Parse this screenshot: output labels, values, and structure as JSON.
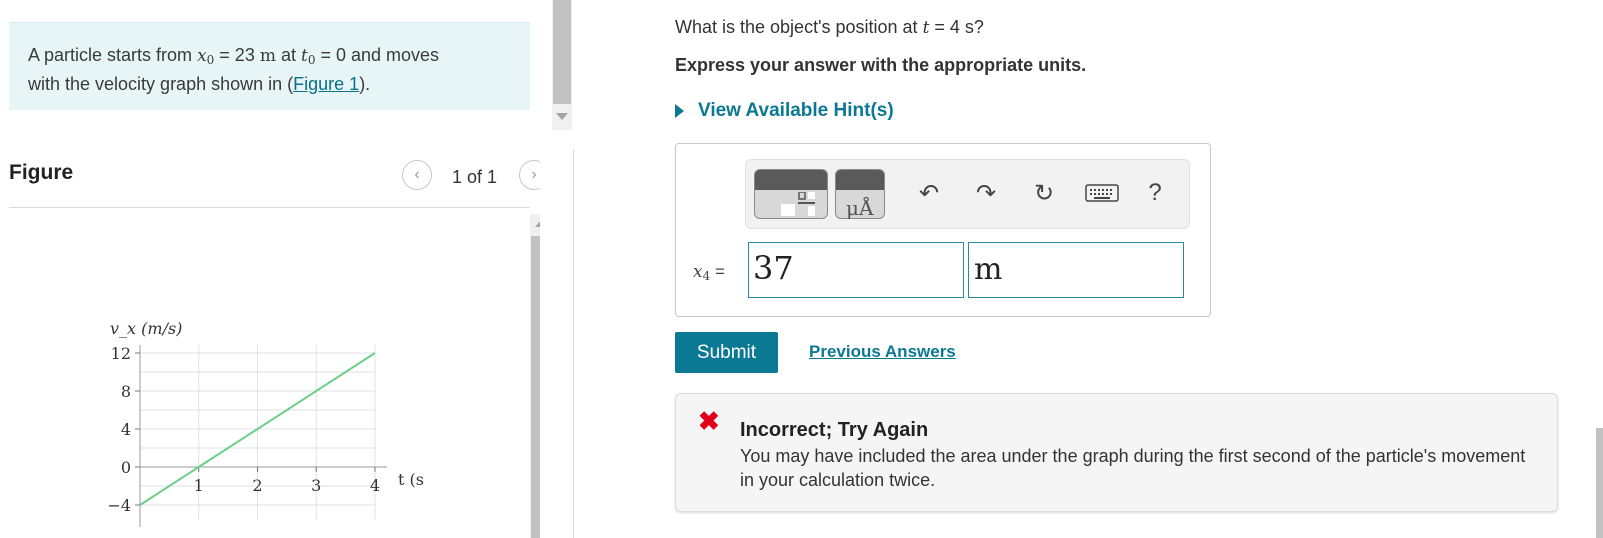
{
  "problem": {
    "text_1": "A particle starts from ",
    "x0_sym": "x",
    "x0_sub": "0",
    "eq_1": " = 23 ",
    "unit_m": "m",
    "text_2": " at ",
    "t0_sym": "t",
    "t0_sub": "0",
    "eq_2": " = 0 and moves",
    "text_3": "with the velocity graph shown in (",
    "figure_link": "Figure 1",
    "text_4": ")."
  },
  "figure": {
    "title": "Figure",
    "pager_text": "1 of 1",
    "prev_icon": "chevron-left-icon",
    "next_icon": "chevron-right-icon"
  },
  "chart_data": {
    "type": "line",
    "ylabel": "v_x (m/s)",
    "xlabel": "t (s)",
    "xlim": [
      0,
      4
    ],
    "ylim": [
      -4,
      12
    ],
    "x_ticks": [
      "1",
      "2",
      "3",
      "4"
    ],
    "y_ticks": [
      "12",
      "8",
      "4",
      "0",
      "−4"
    ],
    "grid": true,
    "series": [
      {
        "x": [
          0,
          4
        ],
        "y": [
          -4,
          12
        ],
        "color": "#6cce8c"
      }
    ]
  },
  "question": {
    "prefix": "What is the object's position at ",
    "t_sym": "t",
    "suffix": " = 4 s?",
    "instruction": "Express your answer with the appropriate units.",
    "hints": "View Available Hint(s)"
  },
  "toolbar": {
    "unit_glyph": "μÅ",
    "undo_icon": "undo-icon",
    "redo_icon": "redo-icon",
    "reset_icon": "reset-icon",
    "keyboard_icon": "keyboard-icon",
    "help": "?"
  },
  "answer": {
    "var_label_sym": "x",
    "var_label_sub": "4",
    "var_label_eq": " =",
    "value": "37",
    "unit": "m"
  },
  "actions": {
    "submit": "Submit",
    "previous_answers": "Previous Answers"
  },
  "feedback": {
    "icon": "x-icon",
    "title": "Incorrect; Try Again",
    "text": "You may have included the area under the graph during the first second of the particle's movement in your calculation twice.",
    "color": "#e0001b"
  }
}
